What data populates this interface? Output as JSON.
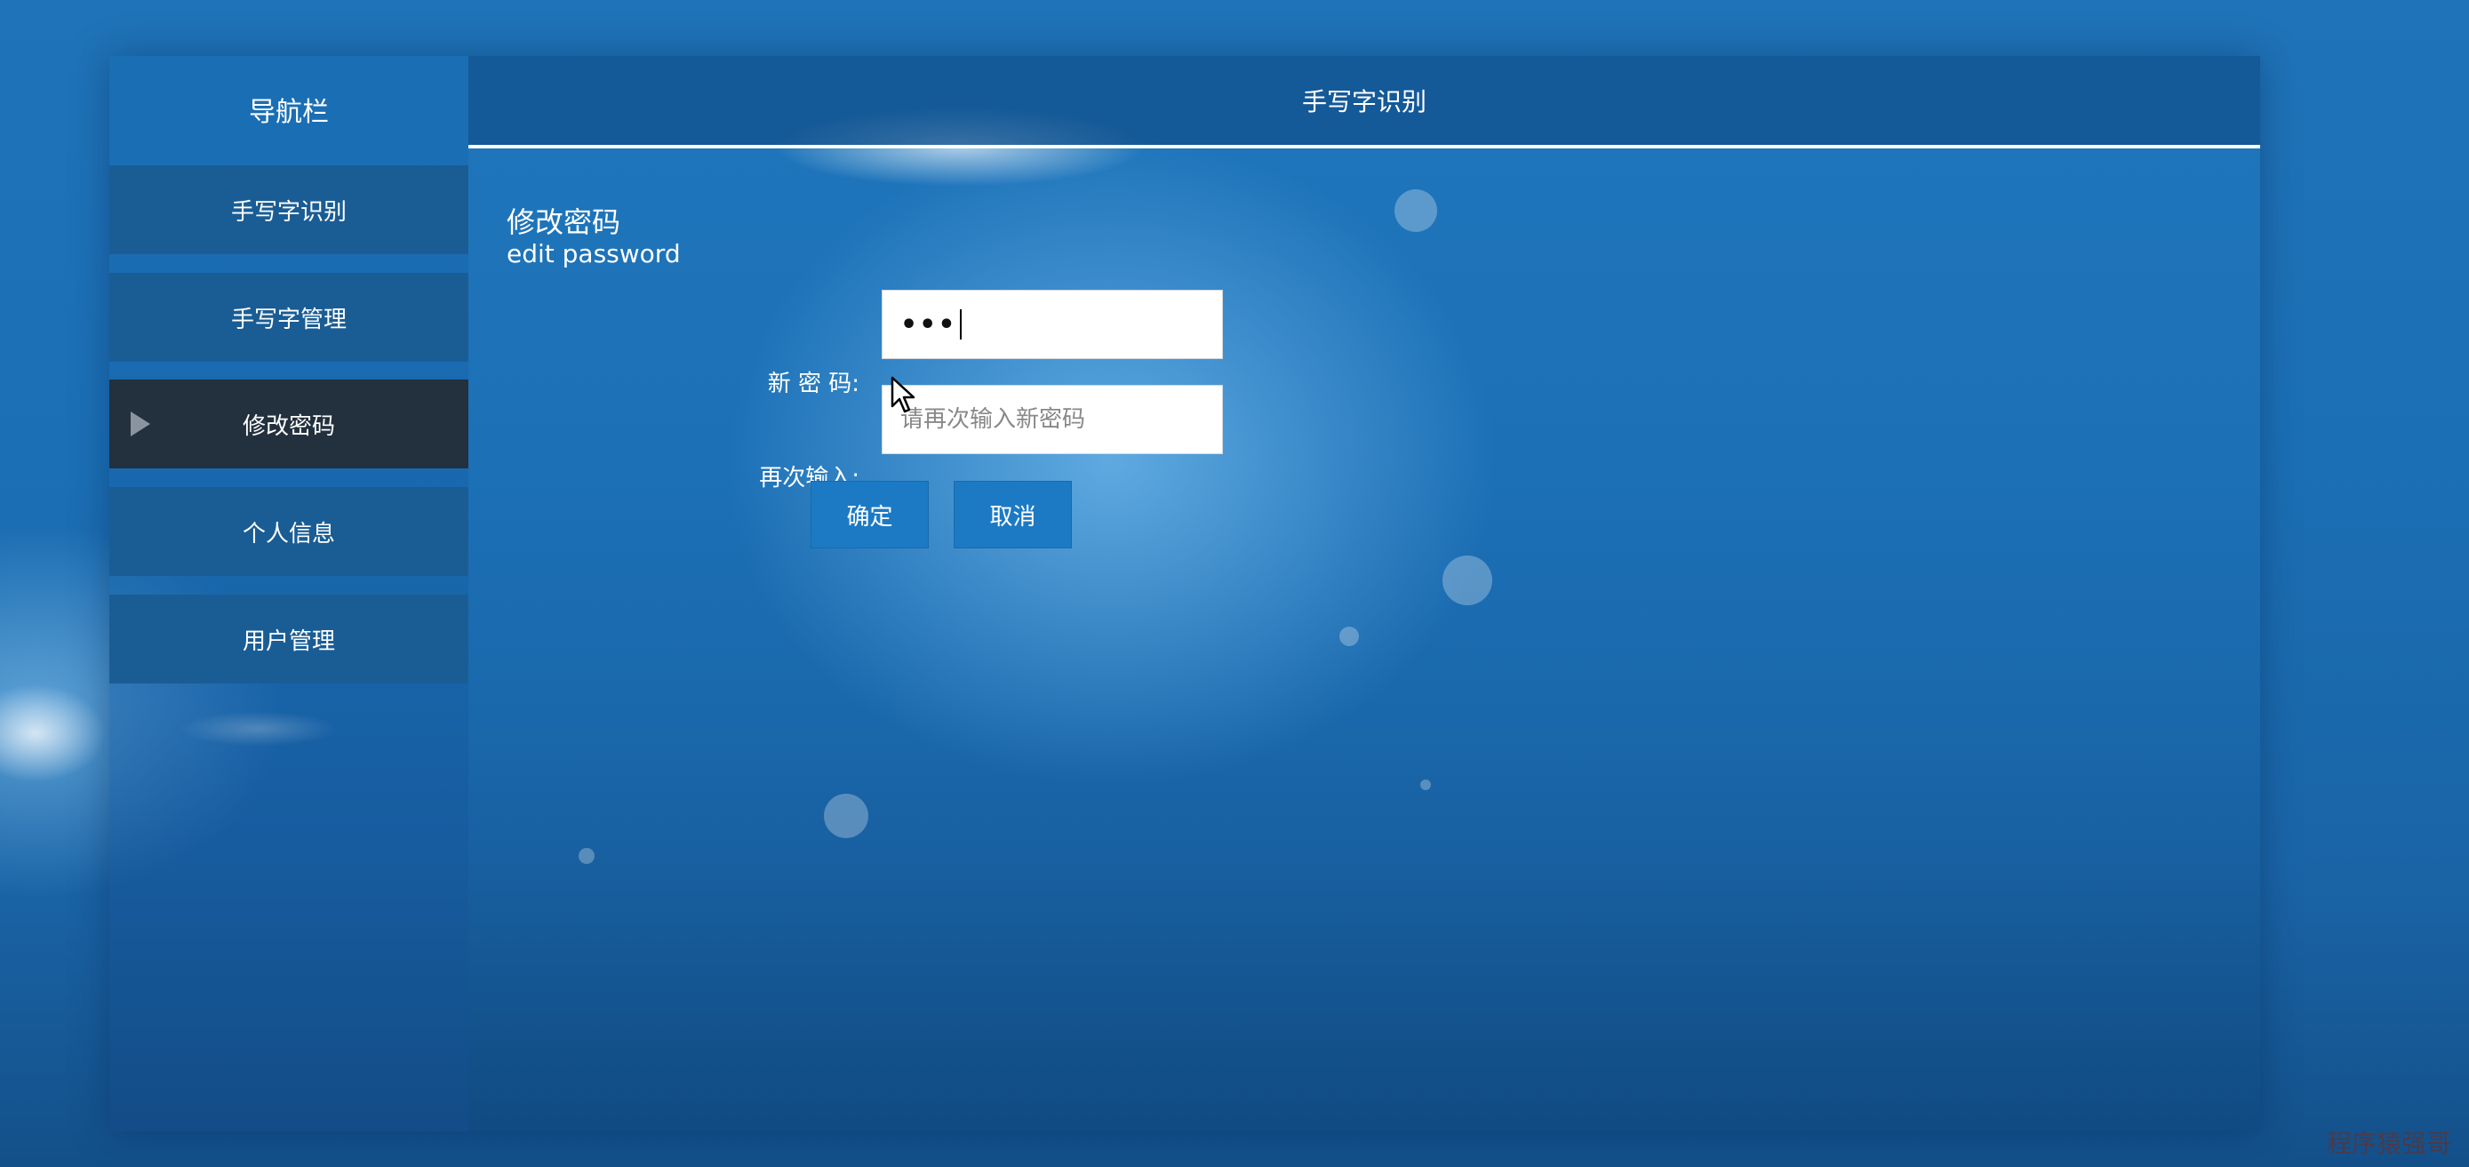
{
  "sidebar": {
    "title": "导航栏",
    "items": [
      {
        "label": "手写字识别",
        "active": false
      },
      {
        "label": "手写字管理",
        "active": false
      },
      {
        "label": "修改密码",
        "active": true
      },
      {
        "label": "个人信息",
        "active": false
      },
      {
        "label": "用户管理",
        "active": false
      }
    ]
  },
  "header": {
    "title": "手写字识别"
  },
  "form": {
    "title": "修改密码",
    "subtitle": "edit password",
    "new_password_label": "新 密 码:",
    "new_password_value": "•••",
    "confirm_label": "再次输入:",
    "confirm_placeholder": "请再次输入新密码",
    "confirm_button": "确定",
    "cancel_button": "取消"
  },
  "watermark": "程序猿强哥",
  "colors": {
    "nav_item": "#1a5d95",
    "nav_active": "#23303e",
    "button": "#1c7ac4"
  }
}
